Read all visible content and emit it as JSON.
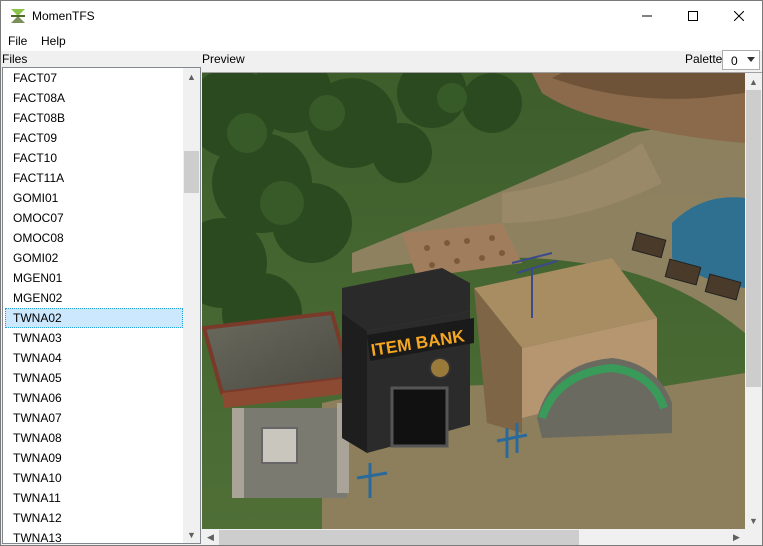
{
  "window": {
    "title": "MomenTFS"
  },
  "menu": {
    "file": "File",
    "help": "Help"
  },
  "labels": {
    "files": "Files",
    "preview": "Preview",
    "palette": "Palette"
  },
  "palette": {
    "value": "0"
  },
  "files": {
    "items": [
      "FACT07",
      "FACT08A",
      "FACT08B",
      "FACT09",
      "FACT10",
      "FACT11A",
      "GOMI01",
      "OMOC07",
      "OMOC08",
      "GOMI02",
      "MGEN01",
      "MGEN02",
      "TWNA02",
      "TWNA03",
      "TWNA04",
      "TWNA05",
      "TWNA06",
      "TWNA07",
      "TWNA08",
      "TWNA09",
      "TWNA10",
      "TWNA11",
      "TWNA12",
      "TWNA13"
    ],
    "selected": "TWNA02"
  },
  "preview": {
    "sign_text": "ITEM BANK"
  },
  "colors": {
    "selection": "#cce8ff",
    "selection_border": "#26a0da",
    "sign": "#f5a623"
  },
  "icons": [
    "app-icon",
    "minimize-icon",
    "maximize-icon",
    "close-icon",
    "chevron-up-icon",
    "chevron-down-icon",
    "chevron-left-icon",
    "chevron-right-icon"
  ]
}
